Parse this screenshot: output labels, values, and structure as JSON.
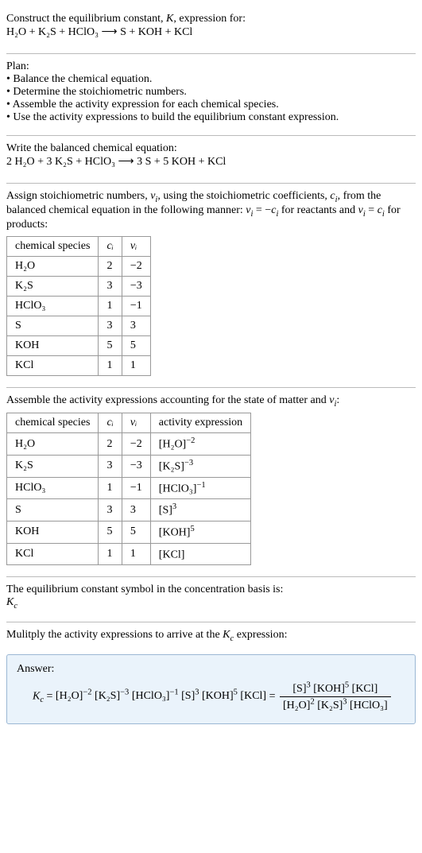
{
  "intro": {
    "line1": "Construct the equilibrium constant, ",
    "K": "K",
    "line1b": ", expression for:",
    "equation": "H₂O + K₂S + HClO₃  ⟶  S + KOH + KCl"
  },
  "plan": {
    "heading": "Plan:",
    "items": [
      "Balance the chemical equation.",
      "Determine the stoichiometric numbers.",
      "Assemble the activity expression for each chemical species.",
      "Use the activity expressions to build the equilibrium constant expression."
    ]
  },
  "balanced": {
    "heading": "Write the balanced chemical equation:",
    "equation": "2 H₂O + 3 K₂S + HClO₃  ⟶  3 S + 5 KOH + KCl"
  },
  "assign": {
    "text1": "Assign stoichiometric numbers, ",
    "nu": "ν",
    "sub_i": "i",
    "text2": ", using the stoichiometric coefficients, ",
    "c": "c",
    "text3": ", from the balanced chemical equation in the following manner: ",
    "rel1a": "ν",
    "rel1b": " = −",
    "rel1c": "c",
    "text4": " for reactants and ",
    "rel2a": "ν",
    "rel2b": " = ",
    "rel2c": "c",
    "text5": " for products:"
  },
  "table1": {
    "headers": [
      "chemical species",
      "cᵢ",
      "νᵢ"
    ],
    "rows": [
      [
        "H₂O",
        "2",
        "−2"
      ],
      [
        "K₂S",
        "3",
        "−3"
      ],
      [
        "HClO₃",
        "1",
        "−1"
      ],
      [
        "S",
        "3",
        "3"
      ],
      [
        "KOH",
        "5",
        "5"
      ],
      [
        "KCl",
        "1",
        "1"
      ]
    ]
  },
  "assemble": {
    "text1": "Assemble the activity expressions accounting for the state of matter and ",
    "nu": "ν",
    "sub_i": "i",
    "text2": ":"
  },
  "table2": {
    "headers": [
      "chemical species",
      "cᵢ",
      "νᵢ",
      "activity expression"
    ],
    "rows": [
      {
        "sp": "H₂O",
        "c": "2",
        "v": "−2",
        "base": "[H₂O]",
        "exp": "−2"
      },
      {
        "sp": "K₂S",
        "c": "3",
        "v": "−3",
        "base": "[K₂S]",
        "exp": "−3"
      },
      {
        "sp": "HClO₃",
        "c": "1",
        "v": "−1",
        "base": "[HClO₃]",
        "exp": "−1"
      },
      {
        "sp": "S",
        "c": "3",
        "v": "3",
        "base": "[S]",
        "exp": "3"
      },
      {
        "sp": "KOH",
        "c": "5",
        "v": "5",
        "base": "[KOH]",
        "exp": "5"
      },
      {
        "sp": "KCl",
        "c": "1",
        "v": "1",
        "base": "[KCl]",
        "exp": ""
      }
    ]
  },
  "symbol": {
    "text": "The equilibrium constant symbol in the concentration basis is:",
    "K": "K",
    "sub": "c"
  },
  "multiply": {
    "text1": "Mulitply the activity expressions to arrive at the ",
    "K": "K",
    "sub": "c",
    "text2": " expression:"
  },
  "answer": {
    "label": "Answer:",
    "K": "K",
    "sub": "c",
    "eq": " = ",
    "lhs_parts": [
      {
        "base": "[H₂O]",
        "exp": "−2"
      },
      {
        "base": "[K₂S]",
        "exp": "−3"
      },
      {
        "base": "[HClO₃]",
        "exp": "−1"
      },
      {
        "base": "[S]",
        "exp": "3"
      },
      {
        "base": "[KOH]",
        "exp": "5"
      },
      {
        "base": "[KCl]",
        "exp": ""
      }
    ],
    "frac": {
      "num": [
        {
          "base": "[S]",
          "exp": "3"
        },
        {
          "base": "[KOH]",
          "exp": "5"
        },
        {
          "base": "[KCl]",
          "exp": ""
        }
      ],
      "den": [
        {
          "base": "[H₂O]",
          "exp": "2"
        },
        {
          "base": "[K₂S]",
          "exp": "3"
        },
        {
          "base": "[HClO₃]",
          "exp": ""
        }
      ]
    }
  },
  "chart_data": {
    "type": "table",
    "tables": [
      {
        "title": "Stoichiometric numbers",
        "columns": [
          "chemical species",
          "c_i",
          "ν_i"
        ],
        "rows": [
          [
            "H2O",
            2,
            -2
          ],
          [
            "K2S",
            3,
            -3
          ],
          [
            "HClO3",
            1,
            -1
          ],
          [
            "S",
            3,
            3
          ],
          [
            "KOH",
            5,
            5
          ],
          [
            "KCl",
            1,
            1
          ]
        ]
      },
      {
        "title": "Activity expressions",
        "columns": [
          "chemical species",
          "c_i",
          "ν_i",
          "activity expression"
        ],
        "rows": [
          [
            "H2O",
            2,
            -2,
            "[H2O]^-2"
          ],
          [
            "K2S",
            3,
            -3,
            "[K2S]^-3"
          ],
          [
            "HClO3",
            1,
            -1,
            "[HClO3]^-1"
          ],
          [
            "S",
            3,
            3,
            "[S]^3"
          ],
          [
            "KOH",
            5,
            5,
            "[KOH]^5"
          ],
          [
            "KCl",
            1,
            1,
            "[KCl]"
          ]
        ]
      }
    ]
  }
}
